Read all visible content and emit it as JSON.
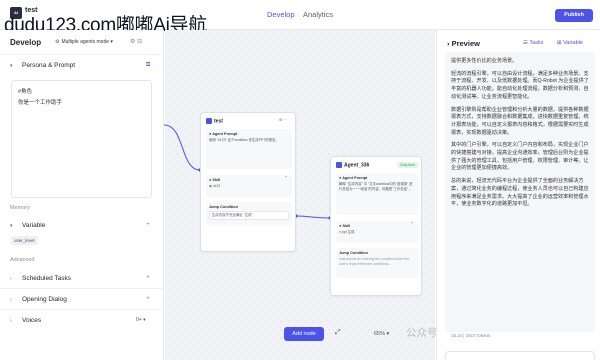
{
  "header": {
    "bot_name": "test",
    "logo_text": "AI",
    "watermark": "dudu123.com嘟嘟Ai导航",
    "tabs": [
      "Develop",
      "Analytics"
    ],
    "publish_label": "Publish"
  },
  "left": {
    "title": "Develop",
    "mode": "Multiple agents mode",
    "persona_title": "Persona & Prompt",
    "prompt_lines": [
      "#角色",
      "你是一个工作助手"
    ],
    "memory_label": "Memory",
    "variable_label": "Variable",
    "variable_chip": "user_level",
    "advanced_label": "Advanced",
    "scheduled_label": "Scheduled Tasks",
    "opening_label": "Opening Dialog",
    "voices_label": "Voices",
    "voices_value": "0+"
  },
  "nodes": {
    "n1": {
      "title": "test",
      "prompt_title": "Agent Prompt",
      "prompt_body": "使用 \"n123\" 这个workflow 来生成PPT的报告。",
      "skill_title": "Skill",
      "skill_item": "n123",
      "jump_title": "Jump Condition",
      "jump_body": "生成内容不完全满足 \"生成\"",
      "badge": ""
    },
    "n2": {
      "title": "Agent_336",
      "badge": "Only time",
      "prompt_title": "Agent Prompt",
      "prompt_body": "解释 \"生成内容\" 中 \"文字workflow中的 回调用\" 进行总结为一\"一段话\"的内容，标题是\"工作总结\" 。",
      "skill_title": "Skill",
      "skill_item": "ppt 生成",
      "jump_title": "Jump Condition",
      "jump_body": "Instructions for entering the condition when the user's reply meets the conditions, ..."
    }
  },
  "canvas": {
    "add_node_label": "Add node",
    "zoom": "65%",
    "watermark": "公众号 · Joseph轻涛"
  },
  "preview": {
    "title": "Preview",
    "tasks_label": "Tasks",
    "variable_label": "Variable",
    "paragraphs": [
      "提供更多性价比的业务场景。",
      "轻流的流程引擎，可以自由设计流程，满足多种业务场景。支持于流程、开发、以及低数据处理。而Q-Robot 为企业提供了丰富的机器人功能，能自动化处理流程，数据分析和预测，自动化测试等。让业务流程更智能化。",
      "数据引擎则是帮助企业管理和分析大量的数据，提供各种数据报表方式，支持数据融合和数据集成，进快数据重复管理。统计报表功能，可以自定义报表内容和格式，根据需要实时生成报表，实现数据驱动决策。",
      "其中的门户引擎，可以自定义门户内容和布局，实现企业门户的快捷搭建与对接，提高企业沟通效率。管理后台则为企业提供了强大的管理工具，包括用户管理、权限管理、审计等。让企业的管理更加便捷高效。",
      "总的来说，轻流无代码平台为企业提供了全面的业务解决方案，通过简化业务的编程过程，使业务人员也可以自己构建应用程序来满足业务需求。大大提高了企业的运营效率和管理水平，使业务数字化的道路更加平坦。"
    ],
    "meta": "15.2s  |  1617 tokens"
  }
}
